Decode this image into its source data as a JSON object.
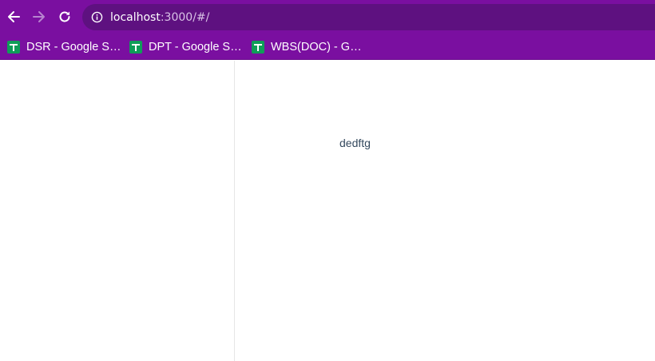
{
  "browser": {
    "url_host": "localhost",
    "url_path": ":3000/#/",
    "icons": {
      "back": "arrow-left-icon",
      "forward": "arrow-right-icon",
      "reload": "reload-icon",
      "info": "info-icon",
      "bookmark": "google-sheets-icon"
    },
    "bookmarks": [
      {
        "label": "DSR - Google S…"
      },
      {
        "label": "DPT - Google S…"
      },
      {
        "label": "WBS(DOC) - G…"
      }
    ]
  },
  "colors": {
    "toolbar": "#7a0fa0",
    "omnibox": "#5e1180",
    "sheets_green": "#0f9d58",
    "content_text": "#34495e"
  },
  "page": {
    "main_text": "dedftg"
  }
}
